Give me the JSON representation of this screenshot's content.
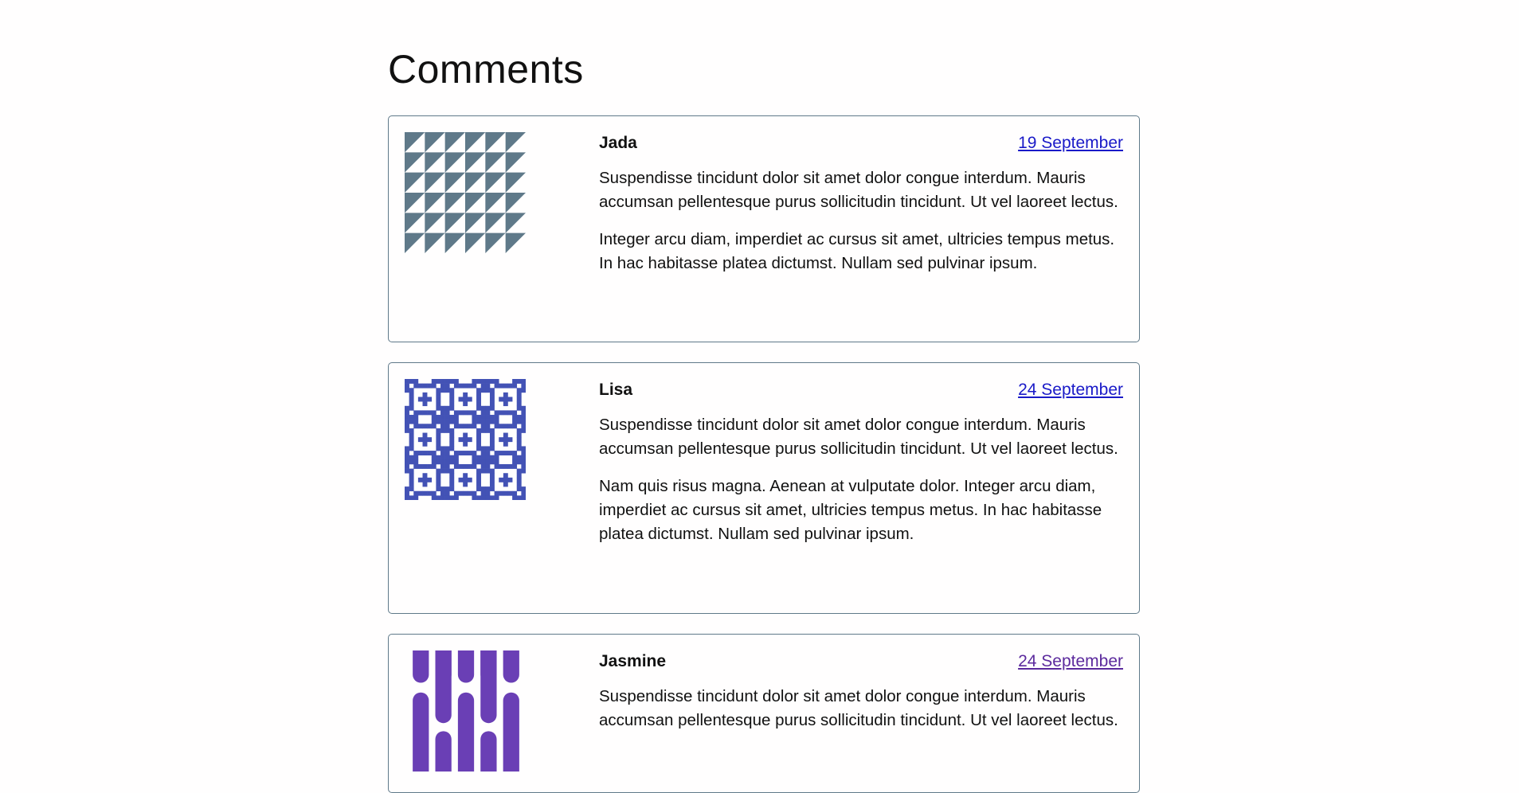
{
  "page": {
    "title": "Comments"
  },
  "comments": [
    {
      "author": "Jada",
      "date": "19 September",
      "paragraphs": [
        "Suspendisse tincidunt dolor sit amet dolor congue interdum. Mauris accumsan pellentesque purus sollicitudin tincidunt. Ut vel laoreet lectus.",
        "Integer arcu diam, imperdiet ac cursus sit amet, ultricies tempus metus. In hac habitasse platea dictumst. Nullam sed pulvinar ipsum."
      ],
      "avatar": {
        "pattern": "triangles",
        "color": "#5f7989"
      }
    },
    {
      "author": "Lisa",
      "date": "24 September",
      "paragraphs": [
        "Suspendisse tincidunt dolor sit amet dolor congue interdum. Mauris accumsan pellentesque purus sollicitudin tincidunt. Ut vel laoreet lectus.",
        "Nam quis risus magna. Aenean at vulputate dolor. Integer arcu diam, imperdiet ac cursus sit amet, ultricies tempus metus. In hac habitasse platea dictumst. Nullam sed pulvinar ipsum."
      ],
      "avatar": {
        "pattern": "pixel-crosses",
        "color": "#4352b5"
      }
    },
    {
      "author": "Jasmine",
      "date": "24 September",
      "paragraphs": [
        "Suspendisse tincidunt dolor sit amet dolor congue interdum. Mauris accumsan pellentesque purus sollicitudin tincidunt. Ut vel laoreet lectus."
      ],
      "avatar": {
        "pattern": "rounded-bars",
        "color": "#6a3fb5"
      }
    }
  ]
}
